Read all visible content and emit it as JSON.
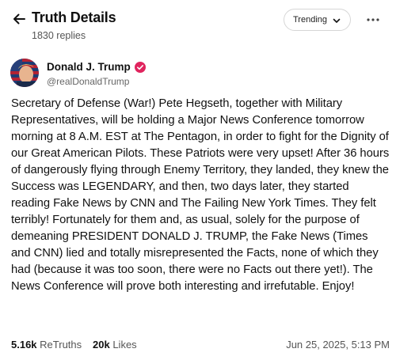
{
  "header": {
    "title": "Truth Details",
    "replies_count": "1830 replies",
    "sort_label": "Trending",
    "back_icon": "arrow-left-icon",
    "more_icon": "more-horizontal-icon"
  },
  "post": {
    "author_name": "Donald J. Trump",
    "author_handle": "@realDonaldTrump",
    "verified_color": "#e0245e",
    "body": "Secretary of Defense (War!) Pete Hegseth, together with Military Representatives, will be holding a Major News Conference tomorrow morning at 8 A.M. EST at The Pentagon, in order to fight for the Dignity of our Great American Pilots. These Patriots were very upset! After 36 hours of dangerously flying through Enemy Territory, they landed, they knew the Success was LEGENDARY, and then, two days later, they started reading Fake News by CNN and The Failing New York Times. They felt terribly! Fortunately for them and, as usual, solely for the purpose of demeaning PRESIDENT DONALD J. TRUMP, the Fake News (Times and CNN) lied and totally misrepresented the Facts, none of which they had (because it was too soon, there were no Facts out there yet!). The News Conference will prove both interesting and irrefutable. Enjoy!",
    "retruths_count": "5.16k",
    "retruths_label": "ReTruths",
    "likes_count": "20k",
    "likes_label": "Likes",
    "timestamp": "Jun 25, 2025, 5:13 PM"
  }
}
